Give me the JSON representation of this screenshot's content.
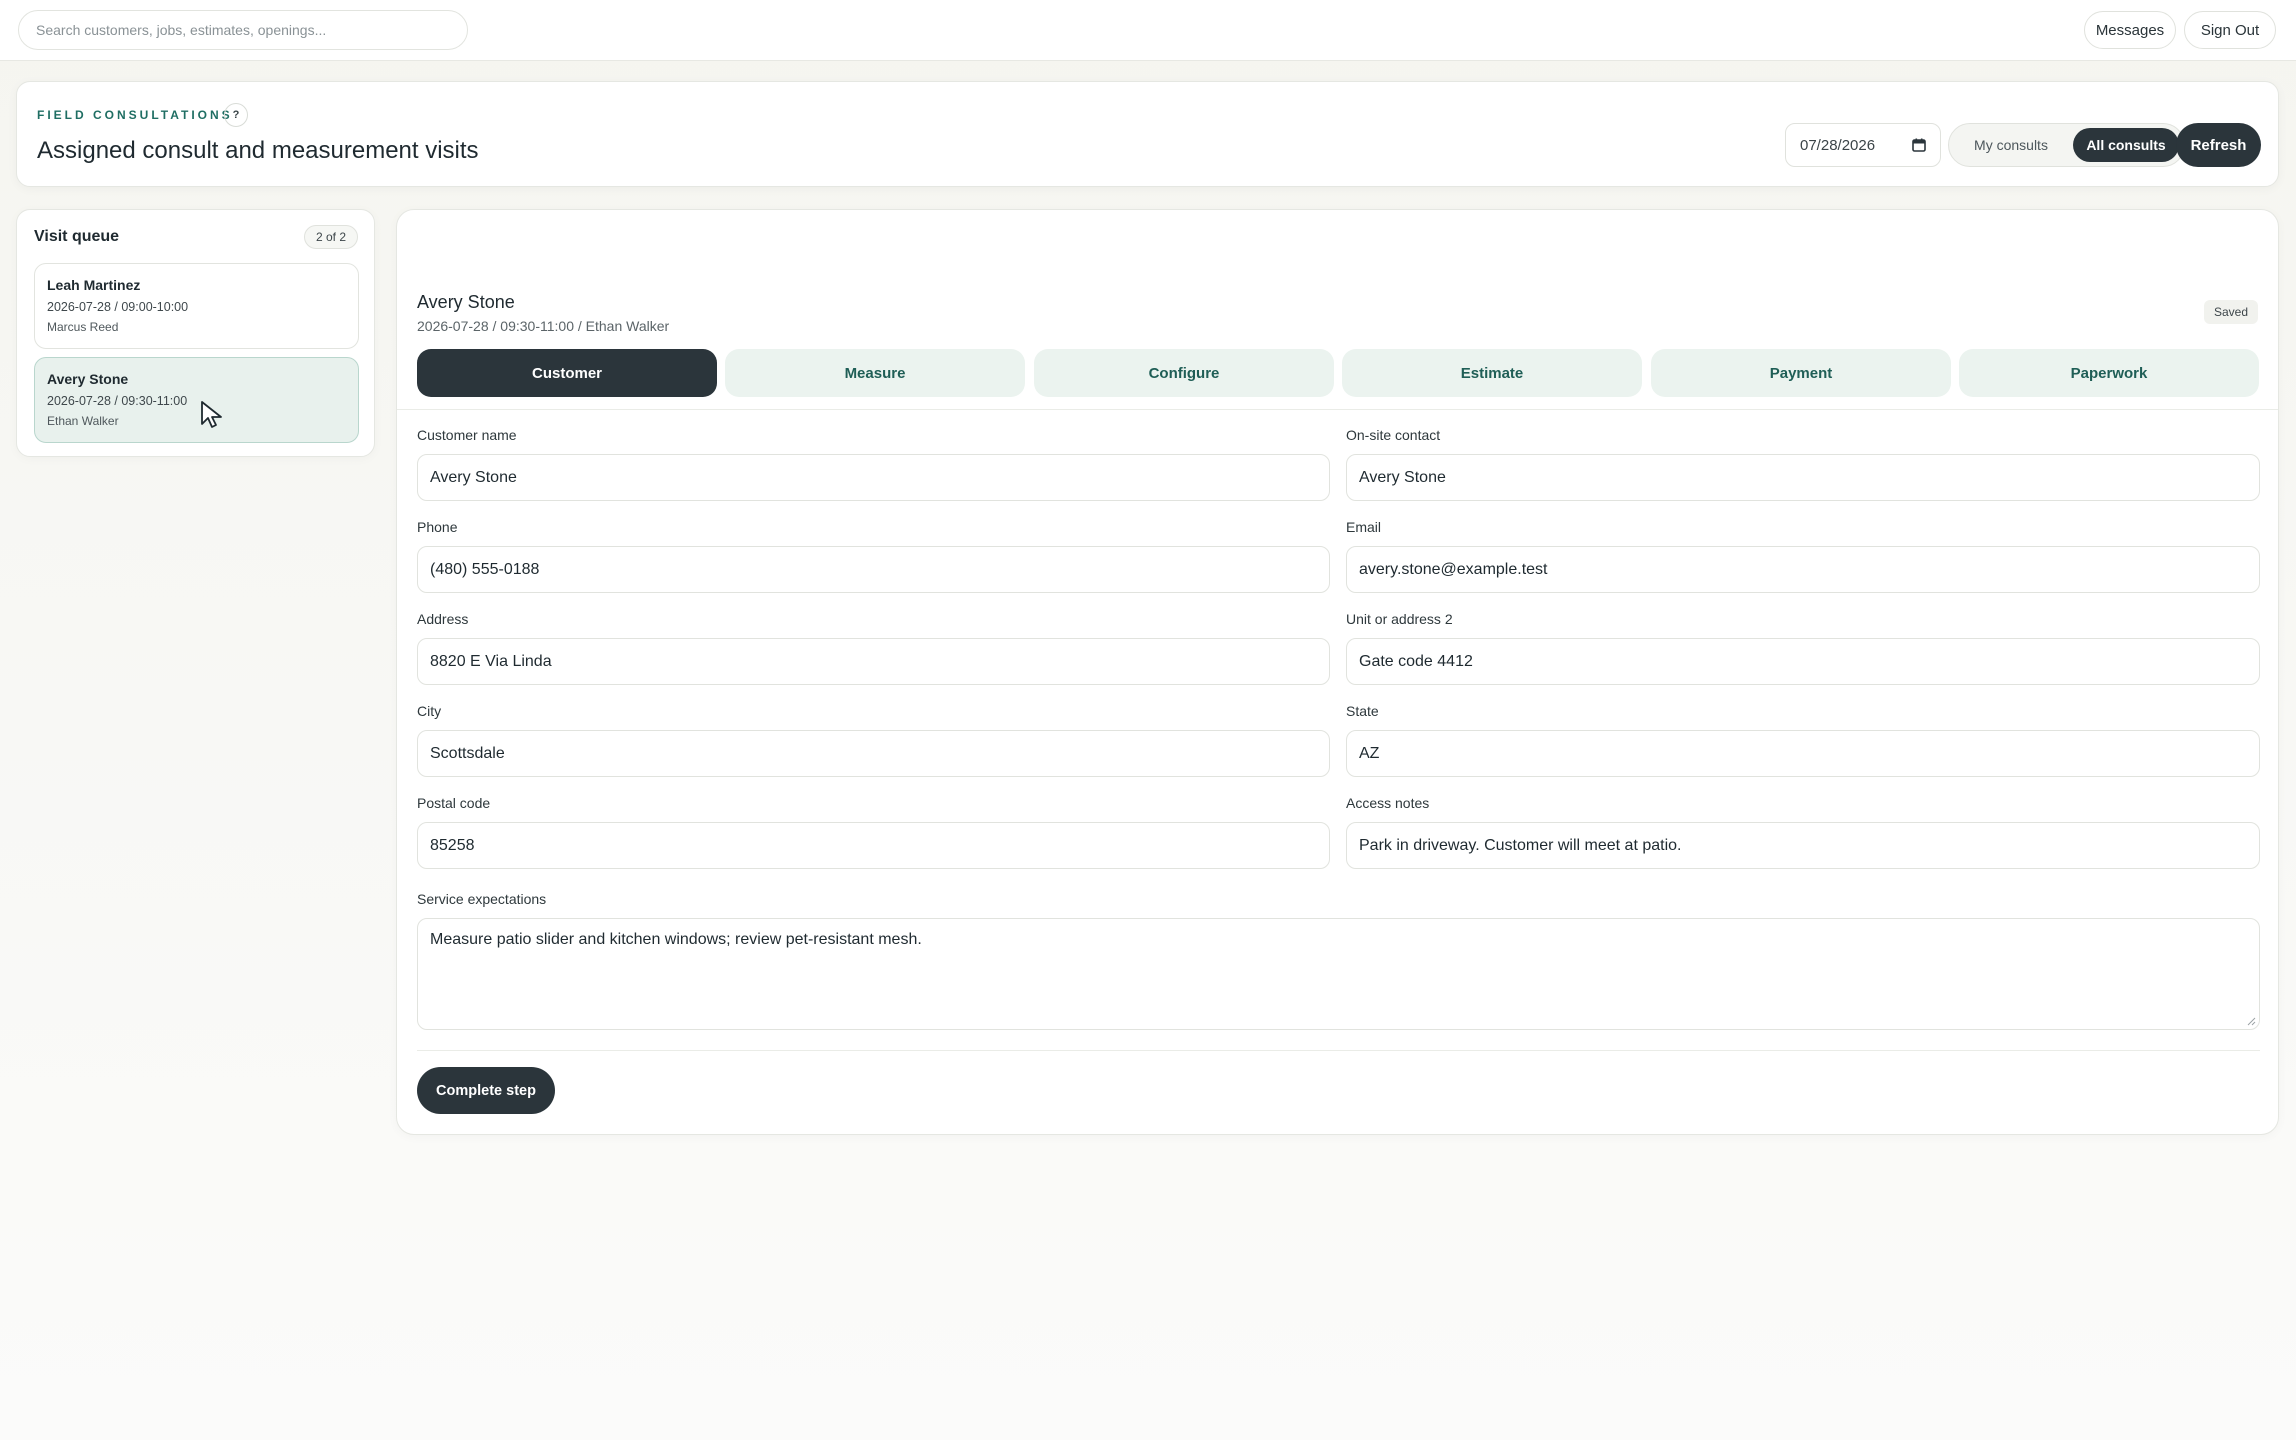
{
  "topbar": {
    "search_placeholder": "Search customers, jobs, estimates, openings...",
    "messages_label": "Messages",
    "signout_label": "Sign Out"
  },
  "header": {
    "eyebrow": "FIELD CONSULTATIONS",
    "help_label": "?",
    "title": "Assigned consult and measurement visits",
    "date_value": "07/28/2026",
    "filter_my": "My consults",
    "filter_all": "All consults",
    "filter_selected": "All consults",
    "refresh_label": "Refresh"
  },
  "queue": {
    "title": "Visit queue",
    "count": "2 of 2",
    "items": [
      {
        "name": "Leah Martinez",
        "time": "2026-07-28 / 09:00-10:00",
        "staff": "Marcus Reed"
      },
      {
        "name": "Avery Stone",
        "time": "2026-07-28 / 09:30-11:00",
        "staff": "Ethan Walker"
      }
    ],
    "selected": "Avery Stone"
  },
  "main": {
    "customer_name": "Avery Stone",
    "subtitle": "2026-07-28 / 09:30-11:00 / Ethan Walker",
    "status": "Saved",
    "tabs": [
      {
        "label": "Customer"
      },
      {
        "label": "Measure"
      },
      {
        "label": "Configure"
      },
      {
        "label": "Estimate"
      },
      {
        "label": "Payment"
      },
      {
        "label": "Paperwork"
      }
    ],
    "active_tab": "Customer",
    "fields": {
      "customer_name": {
        "label": "Customer name",
        "value": "Avery Stone"
      },
      "onsite_contact": {
        "label": "On-site contact",
        "value": "Avery Stone"
      },
      "phone": {
        "label": "Phone",
        "value": "(480) 555-0188"
      },
      "email": {
        "label": "Email",
        "value": "avery.stone@example.test"
      },
      "address": {
        "label": "Address",
        "value": "8820 E Via Linda"
      },
      "address2": {
        "label": "Unit or address 2",
        "value": "Gate code 4412"
      },
      "city": {
        "label": "City",
        "value": "Scottsdale"
      },
      "state": {
        "label": "State",
        "value": "AZ"
      },
      "postal": {
        "label": "Postal code",
        "value": "85258"
      },
      "access_notes": {
        "label": "Access notes",
        "value": "Park in driveway. Customer will meet at patio."
      },
      "service_expectations": {
        "label": "Service expectations",
        "value": "Measure patio slider and kitchen windows; review pet-resistant mesh."
      }
    },
    "complete_label": "Complete step"
  },
  "colors": {
    "primary_dark": "#2b353b",
    "accent_teal": "#1f6e63",
    "tab_bg": "#ebf3ef",
    "selected_item_bg": "#e8f1ed"
  }
}
